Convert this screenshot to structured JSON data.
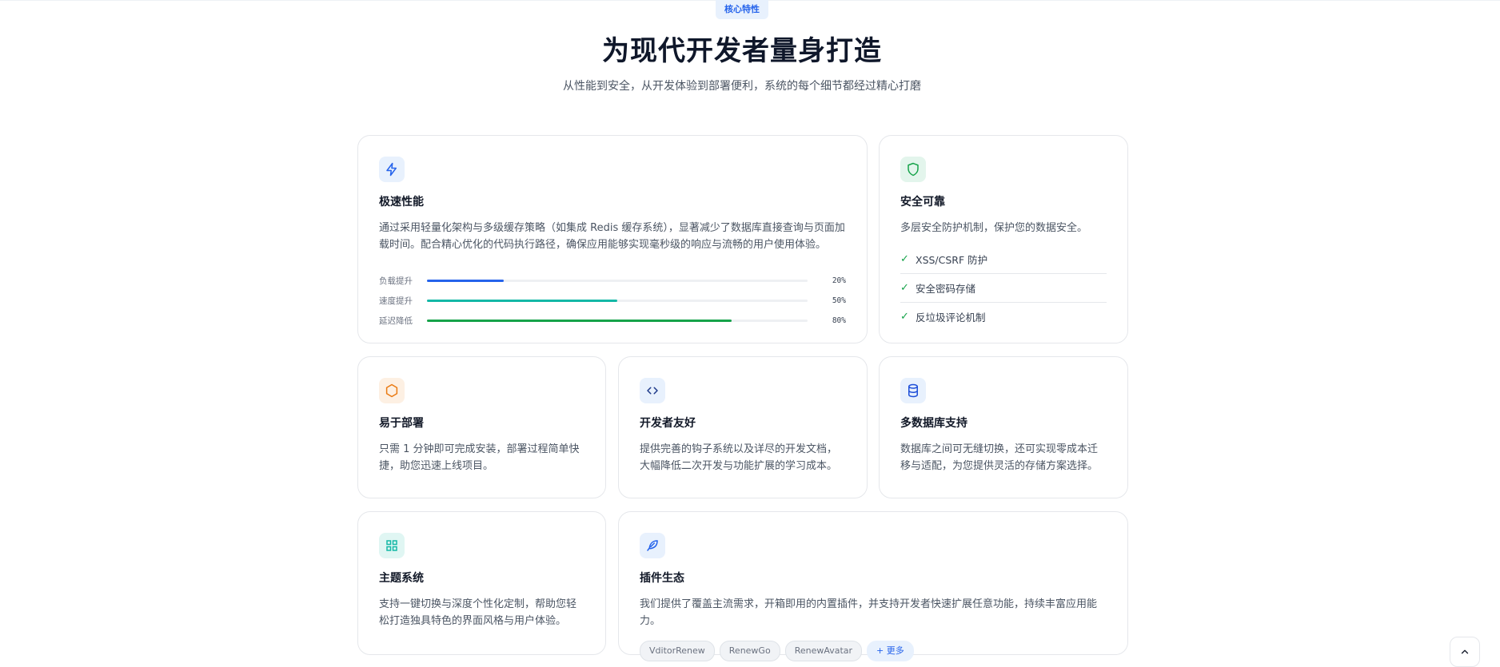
{
  "header": {
    "badge": "核心特性",
    "title": "为现代开发者量身打造",
    "subtitle": "从性能到安全，从开发体验到部署便利，系统的每个细节都经过精心打磨"
  },
  "features": {
    "performance": {
      "icon": "lightning-icon",
      "title": "极速性能",
      "desc": "通过采用轻量化架构与多级缓存策略（如集成 Redis 缓存系统），显著减少了数据库直接查询与页面加载时间。配合精心优化的代码执行路径，确保应用能够实现毫秒级的响应与流畅的用户使用体验。",
      "metrics": [
        {
          "label": "负载提升",
          "value": "20%",
          "fraction": 0.2,
          "color": "#2563eb"
        },
        {
          "label": "速度提升",
          "value": "50%",
          "fraction": 0.5,
          "color": "#14b8a6"
        },
        {
          "label": "延迟降低",
          "value": "80%",
          "fraction": 0.8,
          "color": "#16a34a"
        }
      ]
    },
    "security": {
      "icon": "shield-icon",
      "title": "安全可靠",
      "desc": "多层安全防护机制，保护您的数据安全。",
      "items": [
        "XSS/CSRF 防护",
        "安全密码存储",
        "反垃圾评论机制"
      ]
    },
    "deploy": {
      "icon": "hexagon-icon",
      "title": "易于部署",
      "desc": "只需 1 分钟即可完成安装，部署过程简单快捷，助您迅速上线项目。"
    },
    "developer": {
      "icon": "code-icon",
      "title": "开发者友好",
      "desc": "提供完善的钩子系统以及详尽的开发文档，大幅降低二次开发与功能扩展的学习成本。"
    },
    "database": {
      "icon": "database-icon",
      "title": "多数据库支持",
      "desc": "数据库之间可无缝切换，还可实现零成本迁移与适配，为您提供灵活的存储方案选择。"
    },
    "theme": {
      "icon": "grid-icon",
      "title": "主题系统",
      "desc": "支持一键切换与深度个性化定制，帮助您轻松打造独具特色的界面风格与用户体验。"
    },
    "plugins": {
      "icon": "feather-icon",
      "title": "插件生态",
      "desc": "我们提供了覆盖主流需求，开箱即用的内置插件，并支持开发者快速扩展任意功能，持续丰富应用能力。",
      "tags": [
        "VditorRenew",
        "RenewGo",
        "RenewAvatar"
      ],
      "more": "+ 更多"
    }
  },
  "scroll_top": {
    "icon": "chevron-up-icon"
  }
}
